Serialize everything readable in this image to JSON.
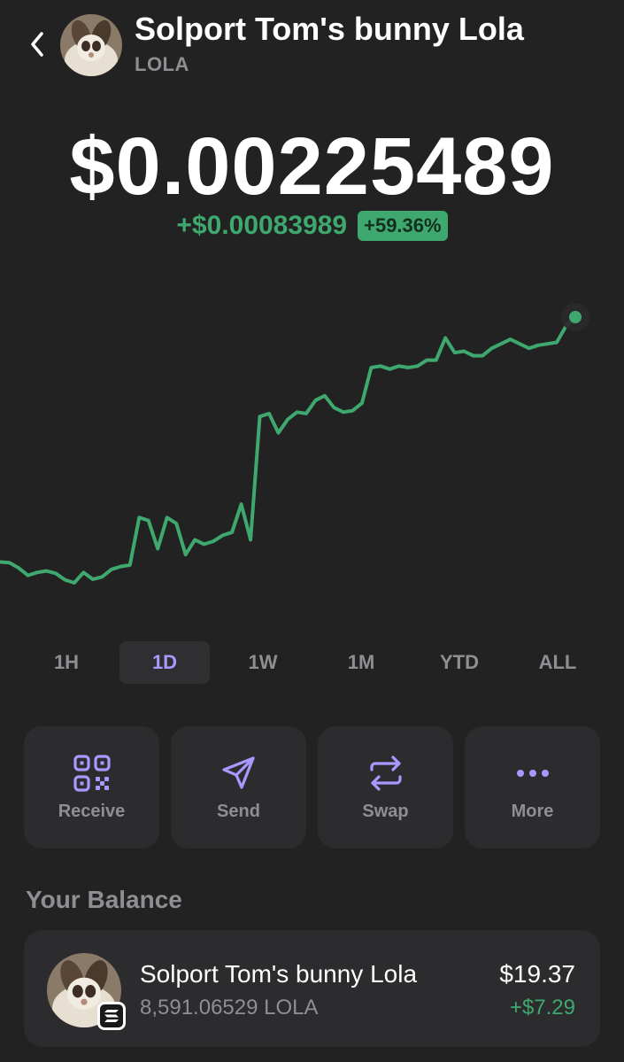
{
  "header": {
    "title": "Solport Tom's bunny Lola",
    "ticker": "LOLA",
    "back_icon": "chevron-left-icon",
    "avatar": "bunny-avatar"
  },
  "price": {
    "current": "$0.00225489",
    "change_amount": "+$0.00083989",
    "change_percent": "+59.36%"
  },
  "colors": {
    "background": "#222222",
    "card": "#2c2c2e",
    "positive": "#3ea86e",
    "accent": "#a898ff",
    "muted": "#8e8e93"
  },
  "chart_data": {
    "type": "line",
    "series": [
      {
        "values": [
          1.43,
          1.428,
          1.41,
          1.385,
          1.395,
          1.4,
          1.392,
          1.37,
          1.36,
          1.395,
          1.372,
          1.38,
          1.405,
          1.415,
          1.42,
          1.58,
          1.57,
          1.475,
          1.58,
          1.56,
          1.455,
          1.505,
          1.49,
          1.5,
          1.52,
          1.53,
          1.625,
          1.505,
          1.92,
          1.93,
          1.865,
          1.91,
          1.935,
          1.93,
          1.975,
          1.99,
          1.95,
          1.935,
          1.94,
          1.965,
          2.085,
          2.09,
          2.08,
          2.09,
          2.085,
          2.09,
          2.11,
          2.11,
          2.185,
          2.135,
          2.14,
          2.125,
          2.125,
          2.15,
          2.165,
          2.18,
          2.165,
          2.15,
          2.16,
          2.165,
          2.17,
          2.225,
          2.255
        ]
      }
    ],
    "live_point": 2.255
  },
  "ranges": {
    "items": [
      "1H",
      "1D",
      "1W",
      "1M",
      "YTD",
      "ALL"
    ],
    "selected": "1D"
  },
  "actions": {
    "receive": {
      "label": "Receive",
      "icon": "qr-code-icon"
    },
    "send": {
      "label": "Send",
      "icon": "paper-plane-icon"
    },
    "swap": {
      "label": "Swap",
      "icon": "swap-arrows-icon"
    },
    "more": {
      "label": "More",
      "icon": "more-dots-icon"
    }
  },
  "balance": {
    "heading": "Your Balance",
    "name": "Solport Tom's bunny Lola",
    "quantity": "8,591.06529 LOLA",
    "usd_value": "$19.37",
    "usd_change": "+$7.29",
    "network_badge": "solana-icon"
  }
}
